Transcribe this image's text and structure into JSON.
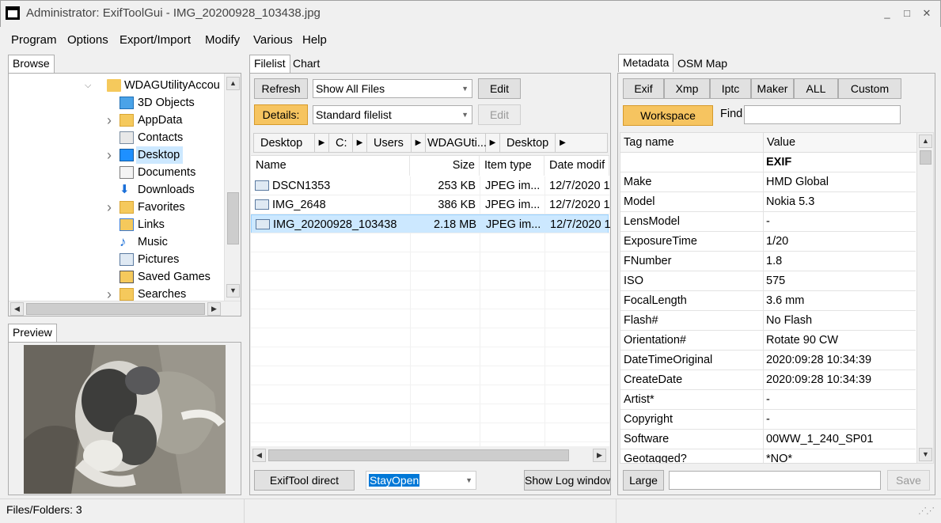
{
  "window": {
    "title": "Administrator: ExifToolGui - IMG_20200928_103438.jpg",
    "minimize": "_",
    "maximize": "□",
    "close": "✕"
  },
  "menu": [
    "Program",
    "Options",
    "Export/Import",
    "Modify",
    "Various",
    "Help"
  ],
  "browse": {
    "tab": "Browse",
    "root": "WDAGUtilityAccou",
    "items": [
      {
        "label": "3D Objects",
        "icon": "3d-objects-icon",
        "expandable": false
      },
      {
        "label": "AppData",
        "icon": "folder-icon",
        "expandable": true
      },
      {
        "label": "Contacts",
        "icon": "contacts-icon",
        "expandable": false
      },
      {
        "label": "Desktop",
        "icon": "desktop-icon",
        "expandable": true,
        "selected": true
      },
      {
        "label": "Documents",
        "icon": "documents-icon",
        "expandable": false
      },
      {
        "label": "Downloads",
        "icon": "downloads-icon",
        "expandable": false
      },
      {
        "label": "Favorites",
        "icon": "favorites-icon",
        "expandable": true
      },
      {
        "label": "Links",
        "icon": "links-icon",
        "expandable": false
      },
      {
        "label": "Music",
        "icon": "music-icon",
        "expandable": false
      },
      {
        "label": "Pictures",
        "icon": "pictures-icon",
        "expandable": false
      },
      {
        "label": "Saved Games",
        "icon": "saved-games-icon",
        "expandable": false
      },
      {
        "label": "Searches",
        "icon": "searches-icon",
        "expandable": true
      }
    ]
  },
  "preview": {
    "tab": "Preview"
  },
  "filelist": {
    "tabs": [
      "Filelist",
      "Chart"
    ],
    "refresh": "Refresh",
    "filter": "Show All Files",
    "edit": "Edit",
    "details": "Details:",
    "details_mode": "Standard filelist",
    "edit2": "Edit",
    "breadcrumb": [
      "Desktop",
      "C:",
      "Users",
      "WDAGUti...",
      "Desktop"
    ],
    "columns": [
      "Name",
      "Size",
      "Item type",
      "Date modif"
    ],
    "rows": [
      {
        "name": "DSCN1353",
        "size": "253 KB",
        "type": "JPEG im...",
        "date": "12/7/2020 1"
      },
      {
        "name": "IMG_2648",
        "size": "386 KB",
        "type": "JPEG im...",
        "date": "12/7/2020 1"
      },
      {
        "name": "IMG_20200928_103438",
        "size": "2.18 MB",
        "type": "JPEG im...",
        "date": "12/7/2020 1"
      }
    ],
    "exiftool_direct": "ExifTool direct",
    "stay_open": "StayOpen",
    "show_log": "Show Log window"
  },
  "metadata": {
    "tabs": [
      "Metadata",
      "OSM Map"
    ],
    "buttons": [
      "Exif",
      "Xmp",
      "Iptc",
      "Maker",
      "ALL",
      "Custom"
    ],
    "workspace": "Workspace",
    "find_label": "Find",
    "find_value": "",
    "columns": [
      "Tag name",
      "Value"
    ],
    "rows": [
      {
        "tag": "",
        "value": "EXIF",
        "bold": true
      },
      {
        "tag": "Make",
        "value": "HMD Global"
      },
      {
        "tag": "Model",
        "value": "Nokia 5.3"
      },
      {
        "tag": "LensModel",
        "value": "-"
      },
      {
        "tag": "ExposureTime",
        "value": "1/20"
      },
      {
        "tag": "FNumber",
        "value": "1.8"
      },
      {
        "tag": "ISO",
        "value": "575"
      },
      {
        "tag": "FocalLength",
        "value": "3.6 mm"
      },
      {
        "tag": "Flash#",
        "value": "No Flash"
      },
      {
        "tag": "Orientation#",
        "value": "Rotate 90 CW"
      },
      {
        "tag": "DateTimeOriginal",
        "value": "2020:09:28 10:34:39"
      },
      {
        "tag": "CreateDate",
        "value": "2020:09:28 10:34:39"
      },
      {
        "tag": "Artist*",
        "value": "-"
      },
      {
        "tag": "Copyright",
        "value": "-"
      },
      {
        "tag": "Software",
        "value": "00WW_1_240_SP01"
      },
      {
        "tag": "Geotagged?",
        "value": "*NO*"
      }
    ],
    "large": "Large",
    "edit_value": "",
    "save": "Save"
  },
  "status": {
    "text": "Files/Folders: 3"
  },
  "colors": {
    "accent_orange": "#f6c460",
    "selection": "#cce8ff",
    "tree_selection": "#cce8ff"
  }
}
